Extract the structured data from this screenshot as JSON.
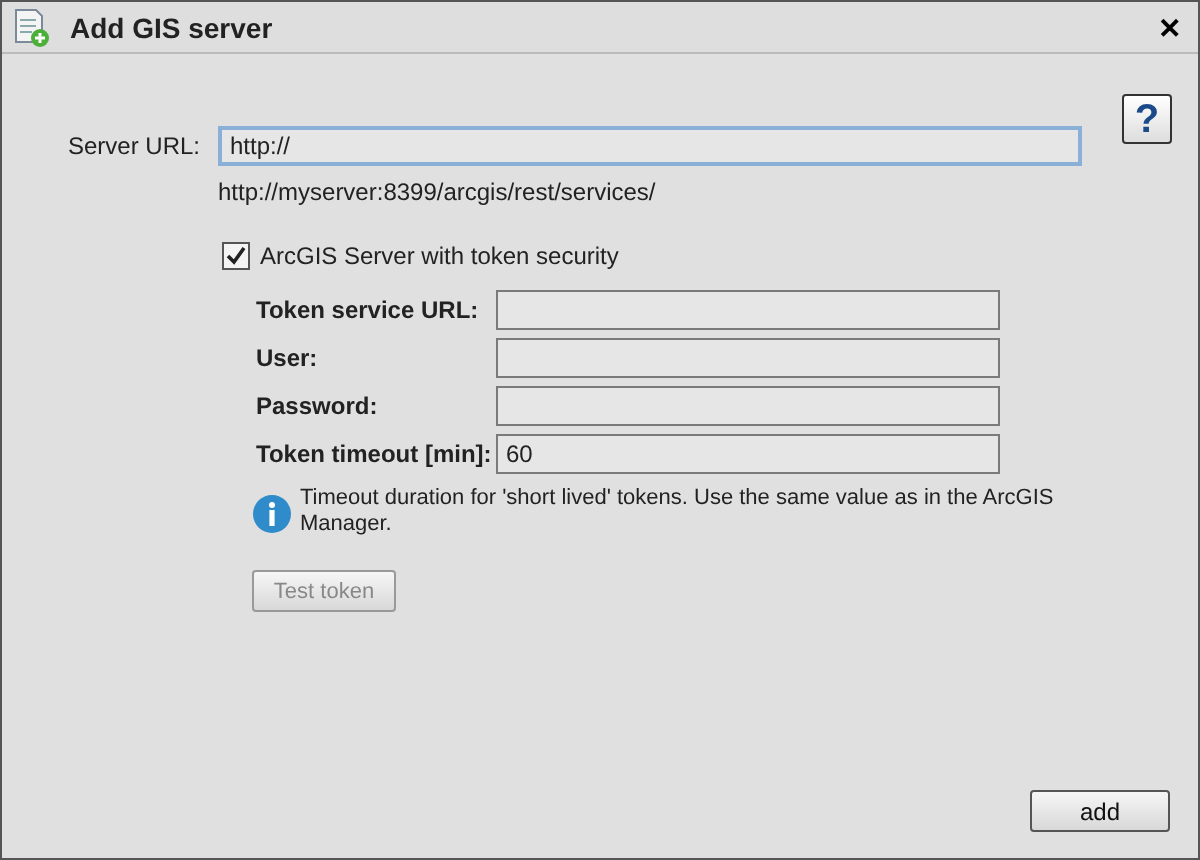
{
  "window": {
    "title": "Add GIS server",
    "close": "✕"
  },
  "help": {
    "label": "?"
  },
  "server_url": {
    "label": "Server URL:",
    "value": "http://",
    "hint": "http://myserver:8399/arcgis/rest/services/"
  },
  "token_security": {
    "label": "ArcGIS Server with token security",
    "checked": true
  },
  "token_fields": [
    {
      "label": "Token service URL:"
    },
    {
      "label": "User:"
    },
    {
      "label": "Password:"
    },
    {
      "label": "Token timeout [min]:",
      "value": "60"
    }
  ],
  "info": "Timeout duration for 'short lived' tokens. Use the same value as in the ArcGIS Manager.",
  "test_button": {
    "label": "Test token",
    "disabled": true
  },
  "add_button": {
    "label": "add"
  }
}
